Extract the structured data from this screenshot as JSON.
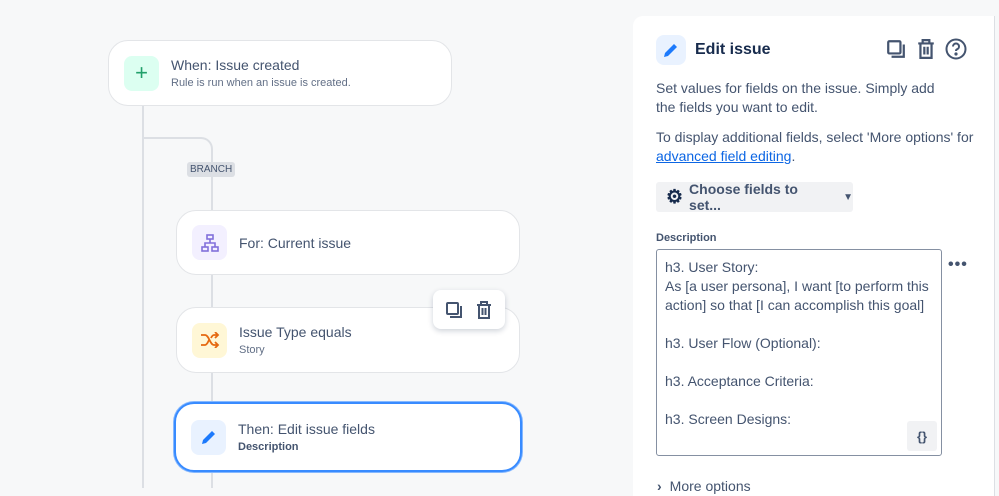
{
  "canvas": {
    "trigger": {
      "title": "When: Issue created",
      "subtitle": "Rule is run when an issue is created."
    },
    "branch_label": "BRANCH",
    "branch_card": {
      "title": "For: Current issue"
    },
    "condition_card": {
      "title": "Issue Type equals",
      "subtitle": "Story"
    },
    "action_card": {
      "title": "Then: Edit issue fields",
      "subtitle": "Description"
    }
  },
  "panel": {
    "title": "Edit issue",
    "intro": "Set values for fields on the issue. Simply add the fields you want to edit.",
    "more_text": "To display additional fields, select 'More options' for ",
    "link": "advanced field editing",
    "link_suffix": ".",
    "choose_fields": "Choose fields to set...",
    "field_label": "Description",
    "field_value": "h3. User Story:\nAs [a user persona], I want [to perform this action] so that [I can accomplish this goal]\n\nh3. User Flow (Optional):\n\nh3. Acceptance Criteria:\n\nh3. Screen Designs:",
    "smart_values_button": "{}",
    "more_options": "More options"
  },
  "colors": {
    "accent": "#388bff",
    "link": "#0c66e4"
  }
}
